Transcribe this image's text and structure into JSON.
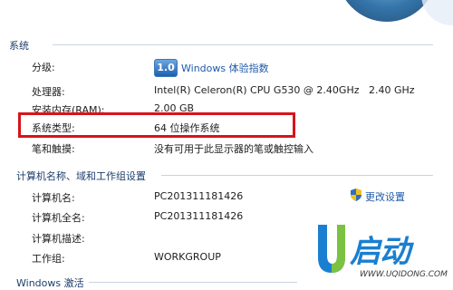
{
  "system": {
    "title": "系统",
    "rating": {
      "label": "分级:",
      "score": "1.0",
      "link": "Windows 体验指数"
    },
    "processor": {
      "label": "处理器:",
      "value": "Intel(R) Celeron(R) CPU G530 @ 2.40GHz   2.40 GHz"
    },
    "ram": {
      "label": "安装内存(RAM):",
      "value": "2.00 GB"
    },
    "type": {
      "label": "系统类型:",
      "value": "64 位操作系统"
    },
    "pen": {
      "label": "笔和触摸:",
      "value": "没有可用于此显示器的笔或触控输入"
    }
  },
  "computer": {
    "title": "计算机名称、域和工作组设置",
    "change_link": "更改设置",
    "name": {
      "label": "计算机名:",
      "value": "PC201311181426"
    },
    "full_name": {
      "label": "计算机全名:",
      "value": "PC201311181426"
    },
    "description": {
      "label": "计算机描述:",
      "value": ""
    },
    "workgroup": {
      "label": "工作组:",
      "value": "WORKGROUP"
    }
  },
  "activation": {
    "title": "Windows 激活"
  },
  "brand": {
    "name": "启动",
    "url": "WWW.UQIDONG.COM"
  },
  "colors": {
    "highlight": "#d7141a",
    "link": "#1f5aa8",
    "section": "#1e3f6b"
  },
  "icons": {
    "badge": "windows-experience-index-badge",
    "shield": "uac-shield-icon"
  }
}
